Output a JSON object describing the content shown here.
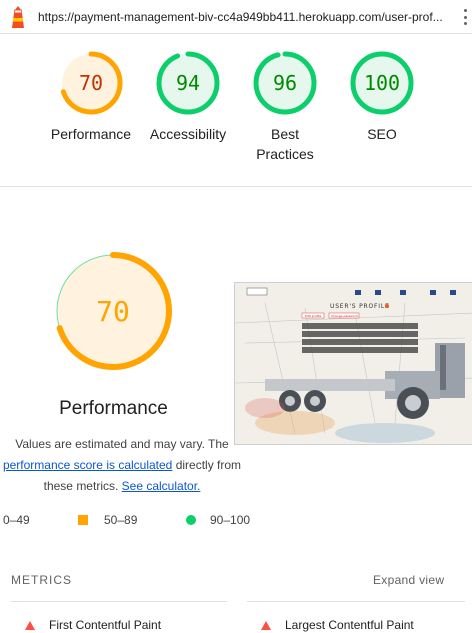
{
  "browser": {
    "url": "https://payment-management-biv-cc4a949bb411.herokuapp.com/user-prof..."
  },
  "scores": [
    {
      "label": "Performance",
      "value": 70,
      "color": "#ffa400",
      "bg": "#fff3e0",
      "text_color": "#c33300"
    },
    {
      "label": "Accessibility",
      "value": 94,
      "color": "#0cce6b",
      "bg": "#e6f8ee",
      "text_color": "#008800"
    },
    {
      "label": "Best Practices",
      "value": 96,
      "color": "#0cce6b",
      "bg": "#e6f8ee",
      "text_color": "#008800"
    },
    {
      "label": "SEO",
      "value": 100,
      "color": "#0cce6b",
      "bg": "#e6f8ee",
      "text_color": "#008800"
    }
  ],
  "main": {
    "score": 70,
    "title": "Performance",
    "desc_text1": "Values are estimated and may vary. The ",
    "desc_link1": "performance score is calculated",
    "desc_text2": " directly from these metrics. ",
    "desc_link2": "See calculator."
  },
  "thumbnail": {
    "title": "USER'S PROFILE",
    "logout": "Logout",
    "edit_btn": "Edit profile",
    "change_btn": "Change password"
  },
  "legend": {
    "fail": "0–49",
    "average": "50–89",
    "pass": "90–100"
  },
  "metrics": {
    "heading": "METRICS",
    "expand": "Expand view",
    "items": [
      "First Contentful Paint",
      "Largest Contentful Paint"
    ]
  }
}
